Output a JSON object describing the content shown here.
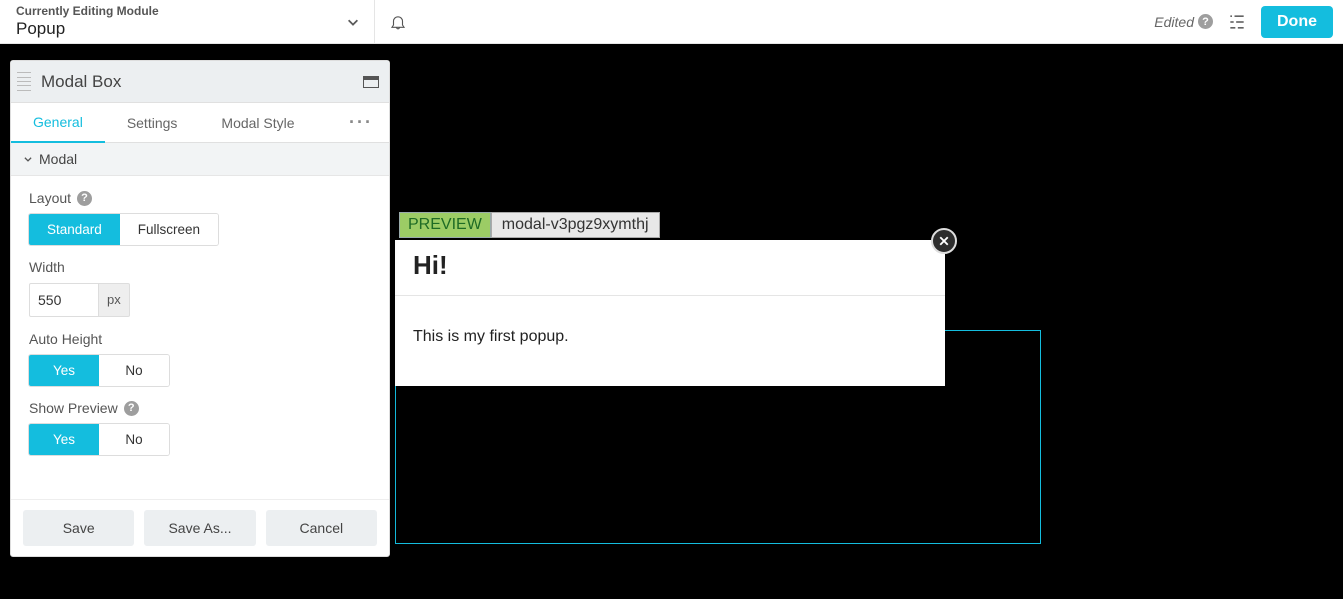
{
  "topbar": {
    "currentlyEditingLabel": "Currently Editing Module",
    "moduleName": "Popup",
    "editedLabel": "Edited",
    "doneLabel": "Done"
  },
  "panel": {
    "title": "Modal Box",
    "tabs": {
      "general": "General",
      "settings": "Settings",
      "modalStyle": "Modal Style"
    },
    "sectionModal": "Modal",
    "fields": {
      "layoutLabel": "Layout",
      "layoutStandard": "Standard",
      "layoutFullscreen": "Fullscreen",
      "widthLabel": "Width",
      "widthValue": "550",
      "widthUnit": "px",
      "autoHeightLabel": "Auto Height",
      "showPreviewLabel": "Show Preview",
      "yes": "Yes",
      "no": "No"
    },
    "footer": {
      "save": "Save",
      "saveAs": "Save As...",
      "cancel": "Cancel"
    }
  },
  "preview": {
    "badge": "PREVIEW",
    "modalId": "modal-v3pgz9xymthj",
    "heading": "Hi!",
    "body": "This is my first popup."
  }
}
